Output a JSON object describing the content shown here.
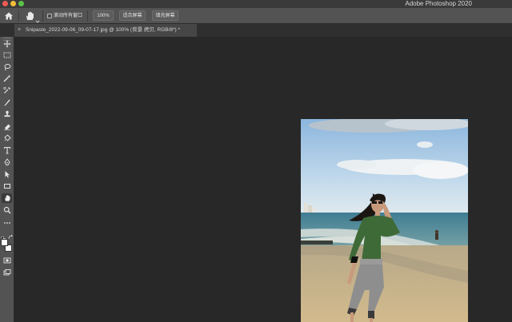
{
  "window": {
    "app_title": "Adobe Photoshop 2020"
  },
  "options_bar": {
    "home_icon": "home-icon",
    "tool_icon": "hand-icon",
    "scroll_all_windows_label": "滚动所有窗口",
    "scroll_all_windows_checked": false,
    "zoom_button_label": "100%",
    "fit_screen_button_label": "适合屏幕",
    "fill_screen_button_label": "填充屏幕"
  },
  "document": {
    "tab_title": "Snipaste_2022-09-06_09-07-17.jpg @ 100% (背景 拷贝, RGB/8*) *",
    "close_icon": "close-icon"
  },
  "tools": [
    {
      "name": "move-tool",
      "icon": "move-icon"
    },
    {
      "name": "marquee-tool",
      "icon": "marquee-icon"
    },
    {
      "name": "lasso-tool",
      "icon": "lasso-icon"
    },
    {
      "name": "quick-select-tool",
      "icon": "magic-wand-icon"
    },
    {
      "name": "crop-tool",
      "icon": "eyedropper-icon"
    },
    {
      "name": "brush-tool",
      "icon": "brush-icon"
    },
    {
      "name": "stamp-tool",
      "icon": "stamp-icon"
    },
    {
      "name": "eraser-tool",
      "icon": "eraser-icon"
    },
    {
      "name": "bucket-tool",
      "icon": "bucket-icon"
    },
    {
      "name": "type-tool",
      "icon": "type-icon"
    },
    {
      "name": "pen-tool",
      "icon": "pen-icon"
    },
    {
      "name": "select-tool",
      "icon": "arrow-icon"
    },
    {
      "name": "shape-tool",
      "icon": "rectangle-icon"
    },
    {
      "name": "hand-tool",
      "icon": "hand-icon"
    },
    {
      "name": "zoom-tool",
      "icon": "zoom-icon"
    },
    {
      "name": "more-tools",
      "icon": "more-icon"
    }
  ],
  "colors": {
    "foreground": "#ffffff",
    "background": "#ffffff",
    "canvas_bg": "#282828",
    "panel_bg": "#535353"
  }
}
